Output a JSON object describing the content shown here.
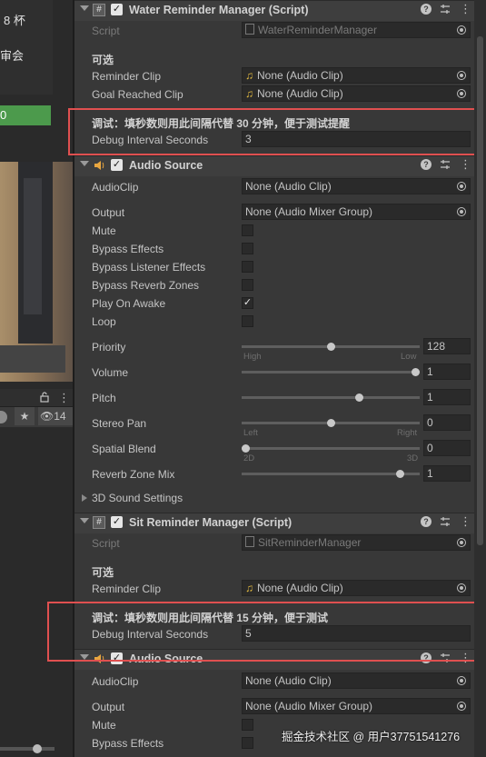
{
  "scene": {
    "cup_text": "8 杯",
    "meeting_text": "审会",
    "green_text": "0",
    "eye_count": "14"
  },
  "water": {
    "title": "Water Reminder Manager (Script)",
    "script_label": "Script",
    "script_value": "WaterReminderManager",
    "optional_label": "可选",
    "reminder_clip_label": "Reminder Clip",
    "reminder_clip_value": "None (Audio Clip)",
    "goal_clip_label": "Goal Reached Clip",
    "goal_clip_value": "None (Audio Clip)",
    "debug_header": "调试：填秒数则用此间隔代替 30 分钟，便于测试提醒",
    "debug_label": "Debug Interval Seconds",
    "debug_value": "3"
  },
  "audio1": {
    "title": "Audio Source",
    "audioclip_label": "AudioClip",
    "audioclip_value": "None (Audio Clip)",
    "output_label": "Output",
    "output_value": "None (Audio Mixer Group)",
    "mute_label": "Mute",
    "bypass_effects_label": "Bypass Effects",
    "bypass_listener_label": "Bypass Listener Effects",
    "bypass_reverb_label": "Bypass Reverb Zones",
    "play_on_awake_label": "Play On Awake",
    "loop_label": "Loop",
    "priority_label": "Priority",
    "priority_value": "128",
    "priority_fraction": 0.5,
    "priority_low_tick": "High",
    "priority_high_tick": "Low",
    "volume_label": "Volume",
    "volume_value": "1",
    "volume_fraction": 1.0,
    "pitch_label": "Pitch",
    "pitch_value": "1",
    "pitch_fraction": 0.67,
    "stereo_label": "Stereo Pan",
    "stereo_value": "0",
    "stereo_fraction": 0.5,
    "stereo_left_tick": "Left",
    "stereo_right_tick": "Right",
    "spatial_label": "Spatial Blend",
    "spatial_value": "0",
    "spatial_fraction": 0.0,
    "spatial_left_tick": "2D",
    "spatial_right_tick": "3D",
    "reverb_mix_label": "Reverb Zone Mix",
    "reverb_mix_value": "1",
    "reverb_mix_fraction": 0.91,
    "sound3d_label": "3D Sound Settings"
  },
  "sit": {
    "title": "Sit Reminder Manager (Script)",
    "script_label": "Script",
    "script_value": "SitReminderManager",
    "optional_label": "可选",
    "reminder_clip_label": "Reminder Clip",
    "reminder_clip_value": "None (Audio Clip)",
    "debug_header": "调试：填秒数则用此间隔代替 15 分钟，便于测试",
    "debug_label": "Debug Interval Seconds",
    "debug_value": "5"
  },
  "audio2": {
    "title": "Audio Source",
    "audioclip_label": "AudioClip",
    "audioclip_value": "None (Audio Clip)",
    "output_label": "Output",
    "output_value": "None (Audio Mixer Group)",
    "mute_label": "Mute",
    "bypass_effects_label": "Bypass Effects"
  },
  "watermark": "掘金技术社区 @ 用户37751541276",
  "colors": {
    "highlight_box": "#e05050",
    "status_green": "#4c9a4c"
  }
}
